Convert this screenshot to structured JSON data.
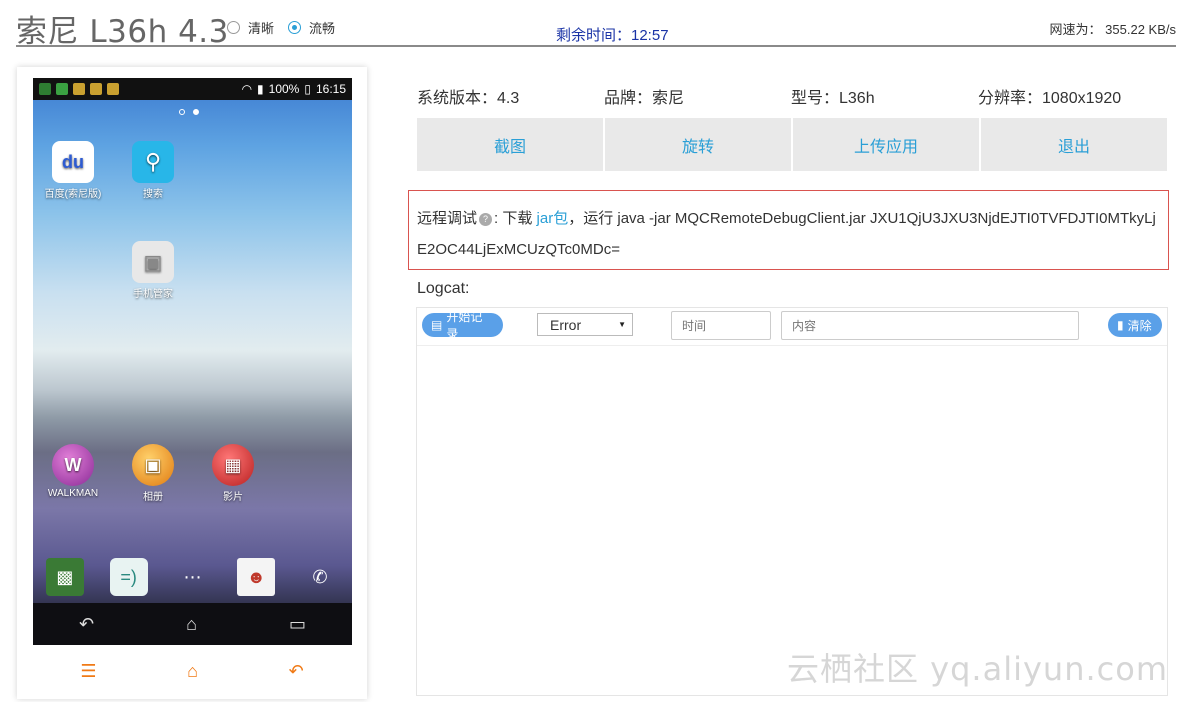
{
  "header": {
    "device_title": "索尼 L36h 4.3",
    "quality_options": [
      {
        "label": "清晰",
        "checked": false
      },
      {
        "label": "流畅",
        "checked": true
      }
    ],
    "remaining_time": "剩余时间：12:57",
    "network_speed": "网速为：  355.22 KB/s"
  },
  "phone": {
    "status_bar": {
      "battery": "100%",
      "time": "16:15",
      "icons": [
        "usb-icon",
        "notification-icon",
        "wifi-icon",
        "signal-icon",
        "battery-icon"
      ]
    },
    "apps": [
      {
        "label": "百度(索尼版)",
        "icon": "du"
      },
      {
        "label": "搜索",
        "icon": "search-icon"
      },
      {
        "label": "手机管家",
        "icon": "assistant-icon"
      },
      {
        "label": "WALKMAN",
        "icon": "walkman-icon"
      },
      {
        "label": "相册",
        "icon": "album-icon"
      },
      {
        "label": "影片",
        "icon": "movie-icon"
      }
    ],
    "dock_icons": [
      "widgets-icon",
      "messages-icon",
      "app-drawer-icon",
      "contacts-icon",
      "phone-icon"
    ],
    "nav_icons": [
      "back-icon",
      "home-icon",
      "recent-apps-icon"
    ],
    "actions": [
      "menu-icon",
      "home-icon",
      "back-icon"
    ]
  },
  "device_info": {
    "system_version": "系统版本：4.3",
    "brand": "品牌：索尼",
    "model": "型号：L36h",
    "resolution": "分辨率：1080x1920"
  },
  "toolbar": {
    "screenshot": "截图",
    "rotate": "旋转",
    "upload_app": "上传应用",
    "exit": "退出"
  },
  "remote_debug": {
    "label": "远程调试",
    "sep": ": 下载 ",
    "link_text": "jar包",
    "command": "，运行 java -jar MQCRemoteDebugClient.jar JXU1QjU3JXU3NjdEJTI0TVFDJTI0MTkyLjE2OC44LjExMCUzQTc0MDc="
  },
  "logcat": {
    "label": "Logcat:",
    "start_button": "开始记录",
    "level": "Error",
    "time_placeholder": "时间",
    "content_placeholder": "内容",
    "clear_button": "清除"
  },
  "watermark": "云栖社区 yq.aliyun.com",
  "colors": {
    "accent": "#2a9fd6",
    "pill": "#5aa0e8",
    "orange": "#f07a16",
    "alert_border": "#d9534f"
  }
}
